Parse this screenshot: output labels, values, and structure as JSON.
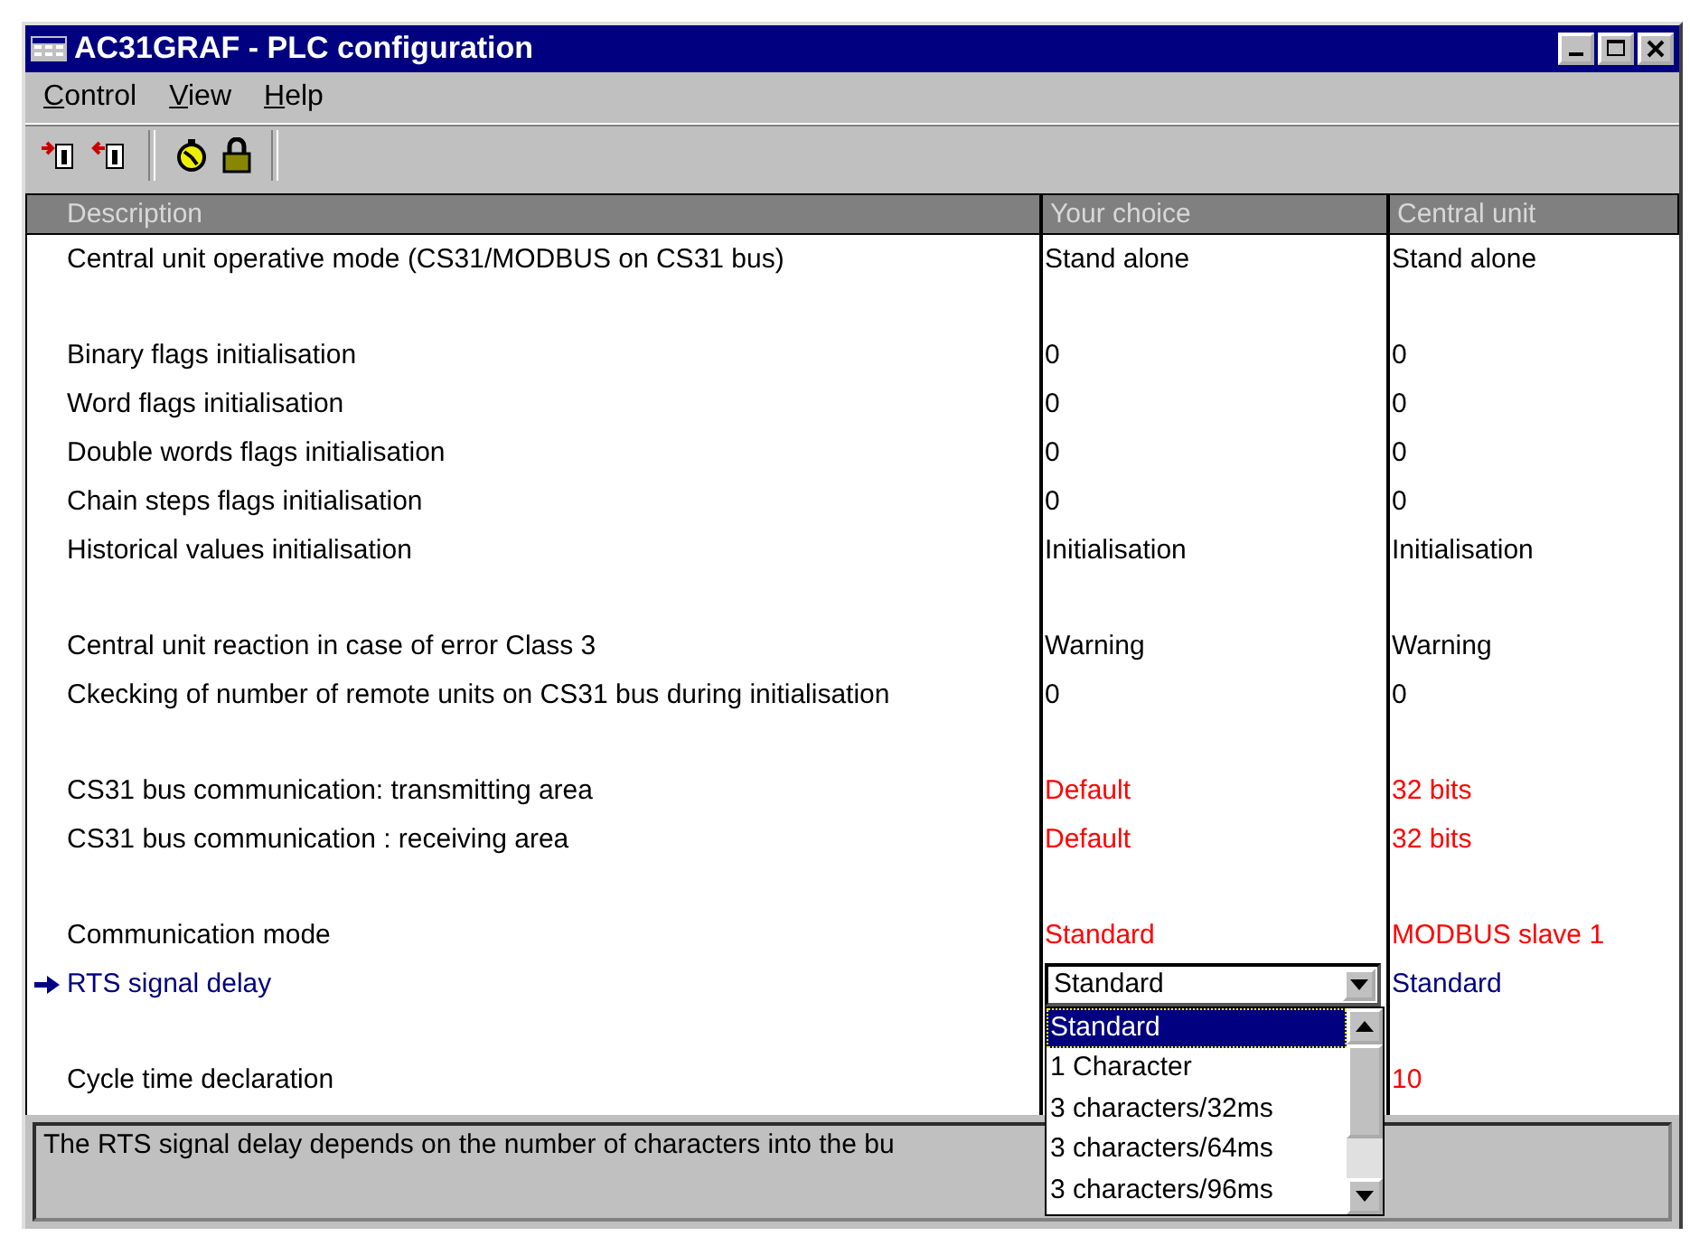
{
  "window": {
    "title": "AC31GRAF - PLC configuration"
  },
  "menu": [
    {
      "label": "Control"
    },
    {
      "label": "View"
    },
    {
      "label": "Help"
    }
  ],
  "columns": [
    "Description",
    "Your choice",
    "Central unit"
  ],
  "groups": [
    {
      "rows": [
        {
          "description": "Central unit operative mode (CS31/MODBUS on CS31 bus)",
          "choice": "Stand alone",
          "central": "Stand alone",
          "changed": false,
          "current": false
        }
      ]
    },
    {
      "rows": [
        {
          "description": "Binary flags initialisation",
          "choice": "0",
          "central": "0",
          "changed": false,
          "current": false
        },
        {
          "description": "Word flags initialisation",
          "choice": "0",
          "central": "0",
          "changed": false,
          "current": false
        },
        {
          "description": "Double words flags initialisation",
          "choice": "0",
          "central": "0",
          "changed": false,
          "current": false
        },
        {
          "description": "Chain steps flags initialisation",
          "choice": "0",
          "central": "0",
          "changed": false,
          "current": false
        },
        {
          "description": "Historical values initialisation",
          "choice": "Initialisation",
          "central": "Initialisation",
          "changed": false,
          "current": false
        }
      ]
    },
    {
      "rows": [
        {
          "description": "Central unit reaction in case of error Class 3",
          "choice": "Warning",
          "central": "Warning",
          "changed": false,
          "current": false
        },
        {
          "description": "Ckecking of number of remote units on CS31 bus during initialisation",
          "choice": "0",
          "central": "0",
          "changed": false,
          "current": false
        }
      ]
    },
    {
      "rows": [
        {
          "description": "CS31 bus communication: transmitting area",
          "choice": "Default",
          "central": "32 bits",
          "changed": true,
          "current": false
        },
        {
          "description": "CS31 bus communication : receiving area",
          "choice": "Default",
          "central": "32 bits",
          "changed": true,
          "current": false
        }
      ]
    },
    {
      "rows": [
        {
          "description": "Communication mode",
          "choice": "Standard",
          "central": "MODBUS slave 1",
          "changed": true,
          "current": false
        },
        {
          "description": "RTS signal delay",
          "dropdown": {
            "value": "Standard",
            "expanded": true,
            "options": [
              {
                "label": "Standard",
                "selected": true
              },
              {
                "label": "1 Character",
                "selected": false
              },
              {
                "label": "3 characters/32ms",
                "selected": false
              },
              {
                "label": "3 characters/64ms",
                "selected": false
              },
              {
                "label": "3 characters/96ms",
                "selected": false
              }
            ]
          },
          "central": "Standard",
          "changed": false,
          "current": true
        }
      ]
    },
    {
      "rows": [
        {
          "description": "Cycle time declaration",
          "central": "10",
          "changed": true,
          "current": false
        }
      ]
    }
  ],
  "status": {
    "text": "The RTS signal delay depends on the number of characters into the bu"
  }
}
